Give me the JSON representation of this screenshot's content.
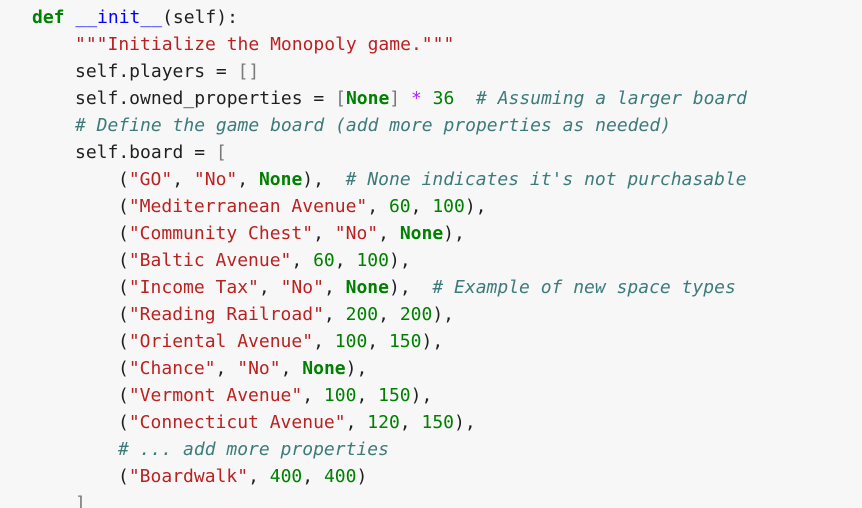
{
  "code": {
    "lines": [
      {
        "indent": 0,
        "tokens": [
          {
            "t": "def",
            "c": "kw"
          },
          {
            "t": " ",
            "c": "txt"
          },
          {
            "t": "__init__",
            "c": "fn"
          },
          {
            "t": "(self):",
            "c": "txt"
          }
        ]
      },
      {
        "indent": 1,
        "tokens": [
          {
            "t": "\"\"\"Initialize the Monopoly game.\"\"\"",
            "c": "str"
          }
        ]
      },
      {
        "indent": 1,
        "tokens": [
          {
            "t": "self.players = ",
            "c": "txt"
          },
          {
            "t": "[]",
            "c": "brk"
          }
        ]
      },
      {
        "indent": 1,
        "tokens": [
          {
            "t": "self.owned_properties = ",
            "c": "txt"
          },
          {
            "t": "[",
            "c": "brk"
          },
          {
            "t": "None",
            "c": "kw"
          },
          {
            "t": "]",
            "c": "brk"
          },
          {
            "t": " ",
            "c": "txt"
          },
          {
            "t": "*",
            "c": "op"
          },
          {
            "t": " ",
            "c": "txt"
          },
          {
            "t": "36",
            "c": "num"
          },
          {
            "t": "  ",
            "c": "txt"
          },
          {
            "t": "# Assuming a larger board",
            "c": "cm"
          }
        ]
      },
      {
        "indent": 1,
        "tokens": [
          {
            "t": "# Define the game board (add more properties as needed)",
            "c": "cm"
          }
        ]
      },
      {
        "indent": 1,
        "tokens": [
          {
            "t": "self.board = ",
            "c": "txt"
          },
          {
            "t": "[",
            "c": "brk"
          }
        ]
      },
      {
        "indent": 2,
        "tokens": [
          {
            "t": "(",
            "c": "txt"
          },
          {
            "t": "\"GO\"",
            "c": "str"
          },
          {
            "t": ", ",
            "c": "txt"
          },
          {
            "t": "\"No\"",
            "c": "str"
          },
          {
            "t": ", ",
            "c": "txt"
          },
          {
            "t": "None",
            "c": "kw"
          },
          {
            "t": "),  ",
            "c": "txt"
          },
          {
            "t": "# None indicates it's not purchasable",
            "c": "cm"
          }
        ]
      },
      {
        "indent": 2,
        "tokens": [
          {
            "t": "(",
            "c": "txt"
          },
          {
            "t": "\"Mediterranean Avenue\"",
            "c": "str"
          },
          {
            "t": ", ",
            "c": "txt"
          },
          {
            "t": "60",
            "c": "num"
          },
          {
            "t": ", ",
            "c": "txt"
          },
          {
            "t": "100",
            "c": "num"
          },
          {
            "t": "),",
            "c": "txt"
          }
        ]
      },
      {
        "indent": 2,
        "tokens": [
          {
            "t": "(",
            "c": "txt"
          },
          {
            "t": "\"Community Chest\"",
            "c": "str"
          },
          {
            "t": ", ",
            "c": "txt"
          },
          {
            "t": "\"No\"",
            "c": "str"
          },
          {
            "t": ", ",
            "c": "txt"
          },
          {
            "t": "None",
            "c": "kw"
          },
          {
            "t": "),",
            "c": "txt"
          }
        ]
      },
      {
        "indent": 2,
        "tokens": [
          {
            "t": "(",
            "c": "txt"
          },
          {
            "t": "\"Baltic Avenue\"",
            "c": "str"
          },
          {
            "t": ", ",
            "c": "txt"
          },
          {
            "t": "60",
            "c": "num"
          },
          {
            "t": ", ",
            "c": "txt"
          },
          {
            "t": "100",
            "c": "num"
          },
          {
            "t": "),",
            "c": "txt"
          }
        ]
      },
      {
        "indent": 2,
        "tokens": [
          {
            "t": "(",
            "c": "txt"
          },
          {
            "t": "\"Income Tax\"",
            "c": "str"
          },
          {
            "t": ", ",
            "c": "txt"
          },
          {
            "t": "\"No\"",
            "c": "str"
          },
          {
            "t": ", ",
            "c": "txt"
          },
          {
            "t": "None",
            "c": "kw"
          },
          {
            "t": "),  ",
            "c": "txt"
          },
          {
            "t": "# Example of new space types",
            "c": "cm"
          }
        ]
      },
      {
        "indent": 2,
        "tokens": [
          {
            "t": "(",
            "c": "txt"
          },
          {
            "t": "\"Reading Railroad\"",
            "c": "str"
          },
          {
            "t": ", ",
            "c": "txt"
          },
          {
            "t": "200",
            "c": "num"
          },
          {
            "t": ", ",
            "c": "txt"
          },
          {
            "t": "200",
            "c": "num"
          },
          {
            "t": "),",
            "c": "txt"
          }
        ]
      },
      {
        "indent": 2,
        "tokens": [
          {
            "t": "(",
            "c": "txt"
          },
          {
            "t": "\"Oriental Avenue\"",
            "c": "str"
          },
          {
            "t": ", ",
            "c": "txt"
          },
          {
            "t": "100",
            "c": "num"
          },
          {
            "t": ", ",
            "c": "txt"
          },
          {
            "t": "150",
            "c": "num"
          },
          {
            "t": "),",
            "c": "txt"
          }
        ]
      },
      {
        "indent": 2,
        "tokens": [
          {
            "t": "(",
            "c": "txt"
          },
          {
            "t": "\"Chance\"",
            "c": "str"
          },
          {
            "t": ", ",
            "c": "txt"
          },
          {
            "t": "\"No\"",
            "c": "str"
          },
          {
            "t": ", ",
            "c": "txt"
          },
          {
            "t": "None",
            "c": "kw"
          },
          {
            "t": "),",
            "c": "txt"
          }
        ]
      },
      {
        "indent": 2,
        "tokens": [
          {
            "t": "(",
            "c": "txt"
          },
          {
            "t": "\"Vermont Avenue\"",
            "c": "str"
          },
          {
            "t": ", ",
            "c": "txt"
          },
          {
            "t": "100",
            "c": "num"
          },
          {
            "t": ", ",
            "c": "txt"
          },
          {
            "t": "150",
            "c": "num"
          },
          {
            "t": "),",
            "c": "txt"
          }
        ]
      },
      {
        "indent": 2,
        "tokens": [
          {
            "t": "(",
            "c": "txt"
          },
          {
            "t": "\"Connecticut Avenue\"",
            "c": "str"
          },
          {
            "t": ", ",
            "c": "txt"
          },
          {
            "t": "120",
            "c": "num"
          },
          {
            "t": ", ",
            "c": "txt"
          },
          {
            "t": "150",
            "c": "num"
          },
          {
            "t": "),",
            "c": "txt"
          }
        ]
      },
      {
        "indent": 2,
        "tokens": [
          {
            "t": "# ... add more properties",
            "c": "cm"
          }
        ]
      },
      {
        "indent": 2,
        "tokens": [
          {
            "t": "(",
            "c": "txt"
          },
          {
            "t": "\"Boardwalk\"",
            "c": "str"
          },
          {
            "t": ", ",
            "c": "txt"
          },
          {
            "t": "400",
            "c": "num"
          },
          {
            "t": ", ",
            "c": "txt"
          },
          {
            "t": "400",
            "c": "num"
          },
          {
            "t": ")",
            "c": "txt"
          }
        ]
      },
      {
        "indent": 1,
        "tokens": [
          {
            "t": "]",
            "c": "brk"
          }
        ]
      }
    ]
  }
}
